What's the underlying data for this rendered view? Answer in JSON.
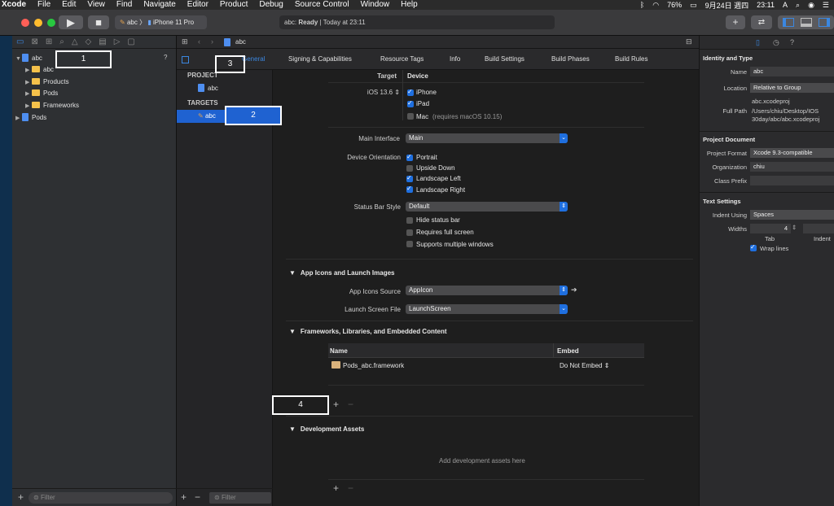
{
  "menubar": {
    "app": "Xcode",
    "items": [
      "File",
      "Edit",
      "View",
      "Find",
      "Navigate",
      "Editor",
      "Product",
      "Debug",
      "Source Control",
      "Window",
      "Help"
    ],
    "battery": "76%",
    "date": "9月24日 週四",
    "time": "23:11"
  },
  "toolbar": {
    "scheme_target": "abc",
    "scheme_device": "iPhone 11 Pro",
    "activity_prefix": "abc: ",
    "activity_status": "Ready",
    "activity_time": "| Today at 23:11"
  },
  "navigator": {
    "tree": [
      {
        "label": "abc",
        "kind": "project"
      },
      {
        "label": "abc",
        "kind": "folder"
      },
      {
        "label": "Products",
        "kind": "folder"
      },
      {
        "label": "Pods",
        "kind": "folder"
      },
      {
        "label": "Frameworks",
        "kind": "folder"
      },
      {
        "label": "Pods",
        "kind": "project"
      }
    ],
    "badge": "?",
    "filter_placeholder": "Filter"
  },
  "jumpbar": {
    "crumb": "abc"
  },
  "tabs": [
    "General",
    "Signing & Capabilities",
    "Resource Tags",
    "Info",
    "Build Settings",
    "Build Phases",
    "Build Rules"
  ],
  "targets_panel": {
    "project_header": "PROJECT",
    "project_item": "abc",
    "targets_header": "TARGETS",
    "target_item": "abc",
    "filter_placeholder": "Filter"
  },
  "deployment": {
    "col_target": "Target",
    "col_device": "Device",
    "ios_version": "iOS 13.6",
    "devices": [
      {
        "label": "iPhone",
        "checked": true
      },
      {
        "label": "iPad",
        "checked": true
      },
      {
        "label": "Mac",
        "checked": false,
        "note": "(requires macOS 10.15)"
      }
    ],
    "main_interface_label": "Main Interface",
    "main_interface_value": "Main",
    "orientation_label": "Device Orientation",
    "orientations": [
      {
        "label": "Portrait",
        "checked": true
      },
      {
        "label": "Upside Down",
        "checked": false
      },
      {
        "label": "Landscape Left",
        "checked": true
      },
      {
        "label": "Landscape Right",
        "checked": true
      }
    ],
    "status_bar_label": "Status Bar Style",
    "status_bar_value": "Default",
    "status_options": [
      {
        "label": "Hide status bar",
        "checked": false
      },
      {
        "label": "Requires full screen",
        "checked": false
      },
      {
        "label": "Supports multiple windows",
        "checked": false
      }
    ]
  },
  "app_icons": {
    "section": "App Icons and Launch Images",
    "source_label": "App Icons Source",
    "source_value": "AppIcon",
    "launch_label": "Launch Screen File",
    "launch_value": "LaunchScreen"
  },
  "frameworks": {
    "section": "Frameworks, Libraries, and Embedded Content",
    "col_name": "Name",
    "col_embed": "Embed",
    "rows": [
      {
        "name": "Pods_abc.framework",
        "embed": "Do Not Embed"
      }
    ]
  },
  "dev_assets": {
    "section": "Development Assets",
    "placeholder": "Add development assets here"
  },
  "inspector": {
    "identity_header": "Identity and Type",
    "name_label": "Name",
    "name_value": "abc",
    "location_label": "Location",
    "location_value": "Relative to Group",
    "location_file": "abc.xcodeproj",
    "fullpath_label": "Full Path",
    "fullpath_value_1": "/Users/chiu/Desktop/IOS",
    "fullpath_value_2": "30day/abc/abc.xcodeproj",
    "doc_header": "Project Document",
    "format_label": "Project Format",
    "format_value": "Xcode 9.3-compatible",
    "org_label": "Organization",
    "org_value": "chiu",
    "prefix_label": "Class Prefix",
    "prefix_value": "",
    "text_header": "Text Settings",
    "indent_label": "Indent Using",
    "indent_value": "Spaces",
    "widths_label": "Widths",
    "tab_width": "4",
    "tab_caption": "Tab",
    "indent_caption": "Indent",
    "wrap_label": "Wrap lines"
  },
  "annotations": [
    "1",
    "2",
    "3",
    "4"
  ]
}
